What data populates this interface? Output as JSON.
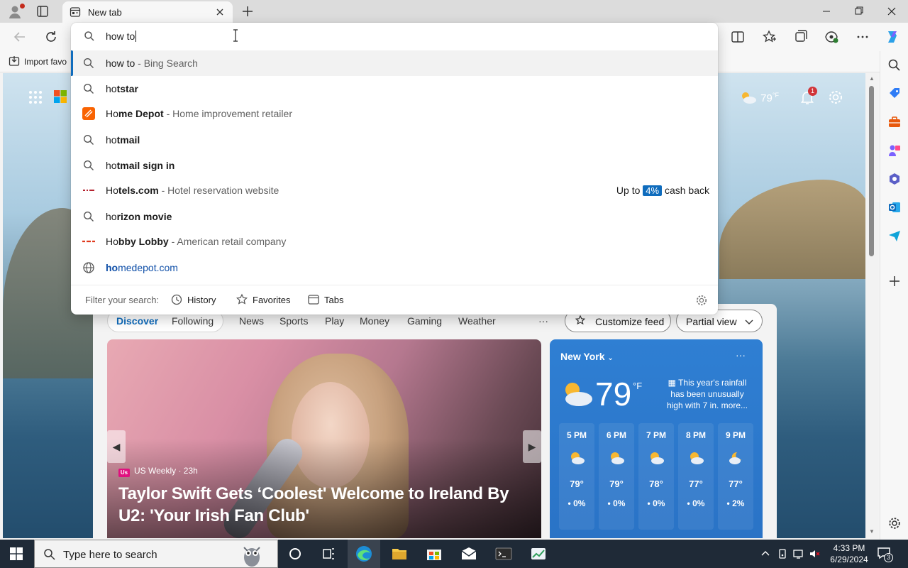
{
  "browser": {
    "tab": {
      "title": "New tab"
    },
    "favorites_bar": {
      "import_label": "Import favo"
    }
  },
  "omnibox": {
    "value": "how to",
    "suggestions": [
      {
        "icon": "search-icon",
        "match": "how to",
        "completion": "",
        "description": " - Bing Search",
        "selected": true
      },
      {
        "icon": "search-icon",
        "match": "ho",
        "completion": "tstar",
        "description": ""
      },
      {
        "icon": "home-depot-logo",
        "match": "Ho",
        "completion": "me Depot",
        "description": " - Home improvement retailer"
      },
      {
        "icon": "search-icon",
        "match": "ho",
        "completion": "tmail",
        "description": ""
      },
      {
        "icon": "search-icon",
        "match": "ho",
        "completion": "tmail sign in",
        "description": ""
      },
      {
        "icon": "hotels-logo",
        "match": "Ho",
        "completion": "tels.com",
        "description": " - Hotel reservation website",
        "cashback": {
          "prefix": "Up to",
          "percent": "4%",
          "suffix": "cash back"
        }
      },
      {
        "icon": "search-icon",
        "match": "ho",
        "completion": "rizon movie",
        "description": ""
      },
      {
        "icon": "hobby-lobby-logo",
        "match": "Ho",
        "completion": "bby Lobby",
        "description": " - American retail company"
      },
      {
        "icon": "globe-icon",
        "match": "ho",
        "completion": "medepot.com",
        "description": "",
        "is_url": true
      }
    ],
    "filter": {
      "label": "Filter your search:",
      "history": "History",
      "favorites": "Favorites",
      "tabs": "Tabs"
    }
  },
  "newtab": {
    "header_weather": {
      "temp": "79",
      "unit": "°F",
      "notifications": "1"
    },
    "feed_nav": {
      "items": [
        "Discover",
        "Following",
        "News",
        "Sports",
        "Play",
        "Money",
        "Gaming",
        "Weather"
      ],
      "active": "Discover",
      "more": "···",
      "customize": "Customize feed",
      "view": "Partial view"
    },
    "hero": {
      "source": "US Weekly · 23h",
      "source_logo": "Us",
      "headline": "Taylor Swift Gets ‘Coolest' Welcome to Ireland By U2: 'Your Irish Fan Club'"
    },
    "weather": {
      "city": "New York",
      "more": "···",
      "temp": "79",
      "unit": "°F",
      "alert": "This year's rainfall has been unusually high with 7 in. more...",
      "hourly": [
        {
          "time": "5 PM",
          "temp": "79°",
          "precip": "0%",
          "icon": "partly-cloudy-icon"
        },
        {
          "time": "6 PM",
          "temp": "79°",
          "precip": "0%",
          "icon": "partly-cloudy-icon"
        },
        {
          "time": "7 PM",
          "temp": "78°",
          "precip": "0%",
          "icon": "partly-cloudy-icon"
        },
        {
          "time": "8 PM",
          "temp": "77°",
          "precip": "0%",
          "icon": "partly-cloudy-icon"
        },
        {
          "time": "9 PM",
          "temp": "77°",
          "precip": "2%",
          "icon": "moon-cloud-icon"
        }
      ]
    }
  },
  "taskbar": {
    "search_placeholder": "Type here to search",
    "time": "4:33 PM",
    "date": "6/29/2024",
    "notification_count": "3"
  },
  "colors": {
    "accent": "#0f6cbd",
    "weather_card": "#2f7fd3",
    "taskbar": "#1f2a37"
  }
}
